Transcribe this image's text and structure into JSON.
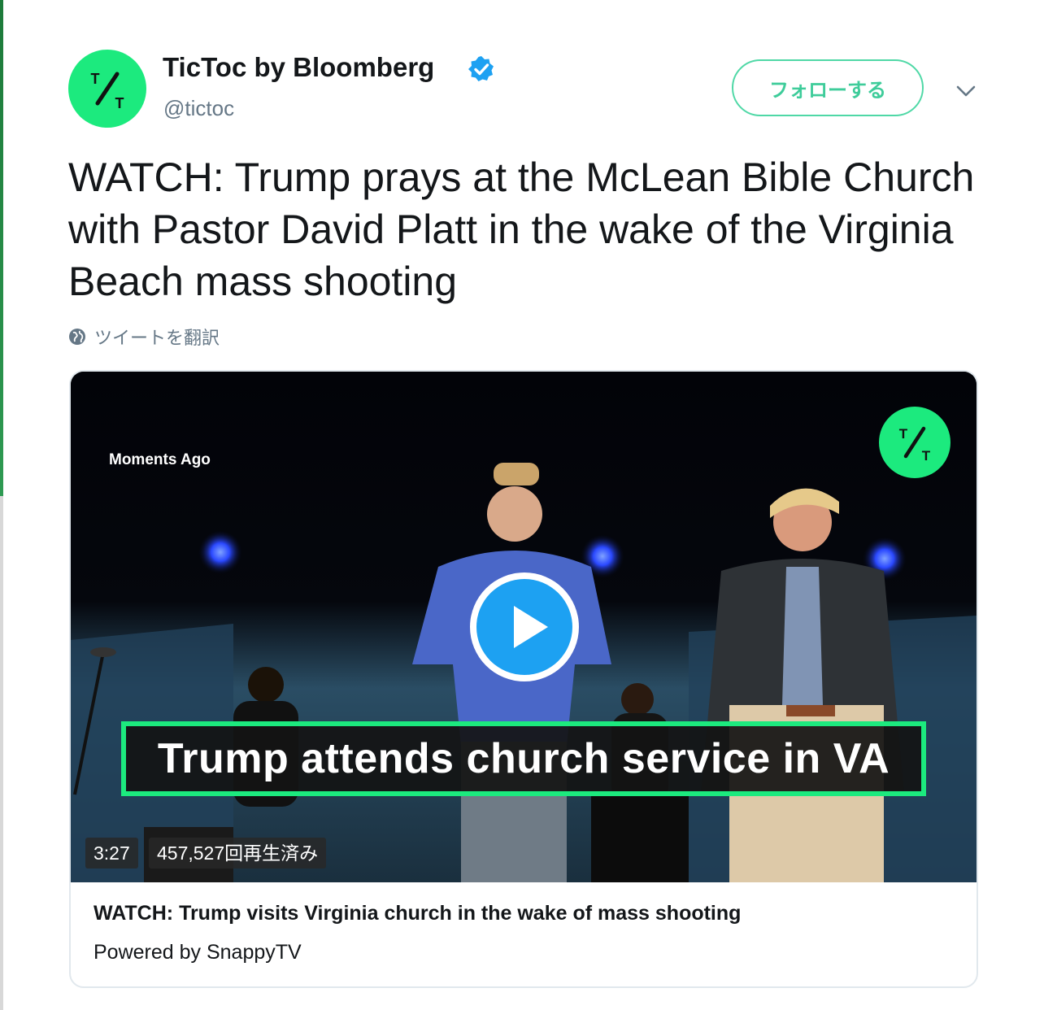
{
  "tweet": {
    "display_name": "TicToc by Bloomberg",
    "handle": "@tictoc",
    "follow_label": "フォローする",
    "text": "WATCH: Trump prays at the McLean Bible Church with Pastor David Platt in the wake of the Virginia Beach mass shooting",
    "translate_label": "ツイートを翻訳",
    "avatar_icon": "tictoc-logo-icon",
    "accent_color": "#1cea7e",
    "link_color": "#1da1f2"
  },
  "card": {
    "video": {
      "overlay_label": "Moments Ago",
      "lower_third": "Trump attends church service in VA",
      "duration": "3:27",
      "views": "457,527回再生済み",
      "play_icon": "play-icon"
    },
    "title": "WATCH: Trump visits Virginia church in the wake of mass shooting",
    "source": "Powered by SnappyTV"
  }
}
